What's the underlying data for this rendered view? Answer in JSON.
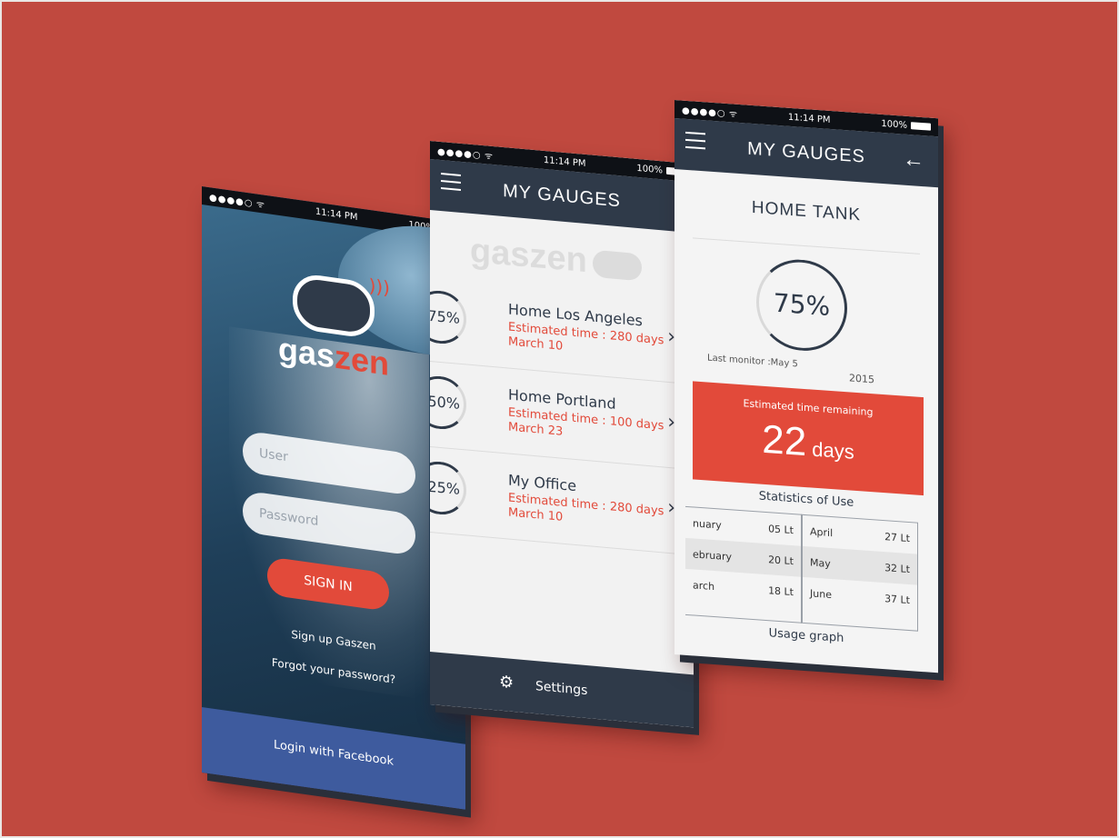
{
  "status": {
    "signal": "●●●●○",
    "wifi": "ᯤ",
    "time": "11:14 PM",
    "battery": "100%"
  },
  "login": {
    "logo_gas": "gas",
    "logo_zen": "zen",
    "user_placeholder": "User",
    "password_placeholder": "Password",
    "signin_label": "SIGN IN",
    "signup_link": "Sign up Gaszen",
    "forgot_link": "Forgot your password?",
    "facebook_label": "Login with Facebook"
  },
  "list": {
    "title": "MY GAUGES",
    "watermark": "gaszen",
    "items": [
      {
        "percent": "75%",
        "name": "Home Los Angeles",
        "estimate": "Estimated time : 280 days",
        "date": "March 10"
      },
      {
        "percent": "50%",
        "name": "Home Portland",
        "estimate": "Estimated time : 100 days",
        "date": "March 23"
      },
      {
        "percent": "25%",
        "name": "My Office",
        "estimate": "Estimated time : 280 days",
        "date": "March 10"
      }
    ],
    "settings_label": "Settings"
  },
  "detail": {
    "title": "MY GAUGES",
    "tank_title": "HOME TANK",
    "percent": "75%",
    "last_monitor": "Last monitor :May 5",
    "last_year": "2015",
    "remaining_label": "Estimated time remaining",
    "remaining_value": "22",
    "remaining_unit": "days",
    "stats_title": "Statistics of Use",
    "stats_left": [
      {
        "month": "nuary",
        "value": "05 Lt"
      },
      {
        "month": "ebruary",
        "value": "20 Lt"
      },
      {
        "month": "arch",
        "value": "18 Lt"
      }
    ],
    "stats_right": [
      {
        "month": "April",
        "value": "27 Lt"
      },
      {
        "month": "May",
        "value": "32 Lt"
      },
      {
        "month": "June",
        "value": "37 Lt"
      }
    ],
    "usage_graph": "Usage graph"
  },
  "colors": {
    "background": "#c0493f",
    "navy": "#2f3a49",
    "accent": "#e24a3a",
    "facebook": "#3e5b9e"
  }
}
